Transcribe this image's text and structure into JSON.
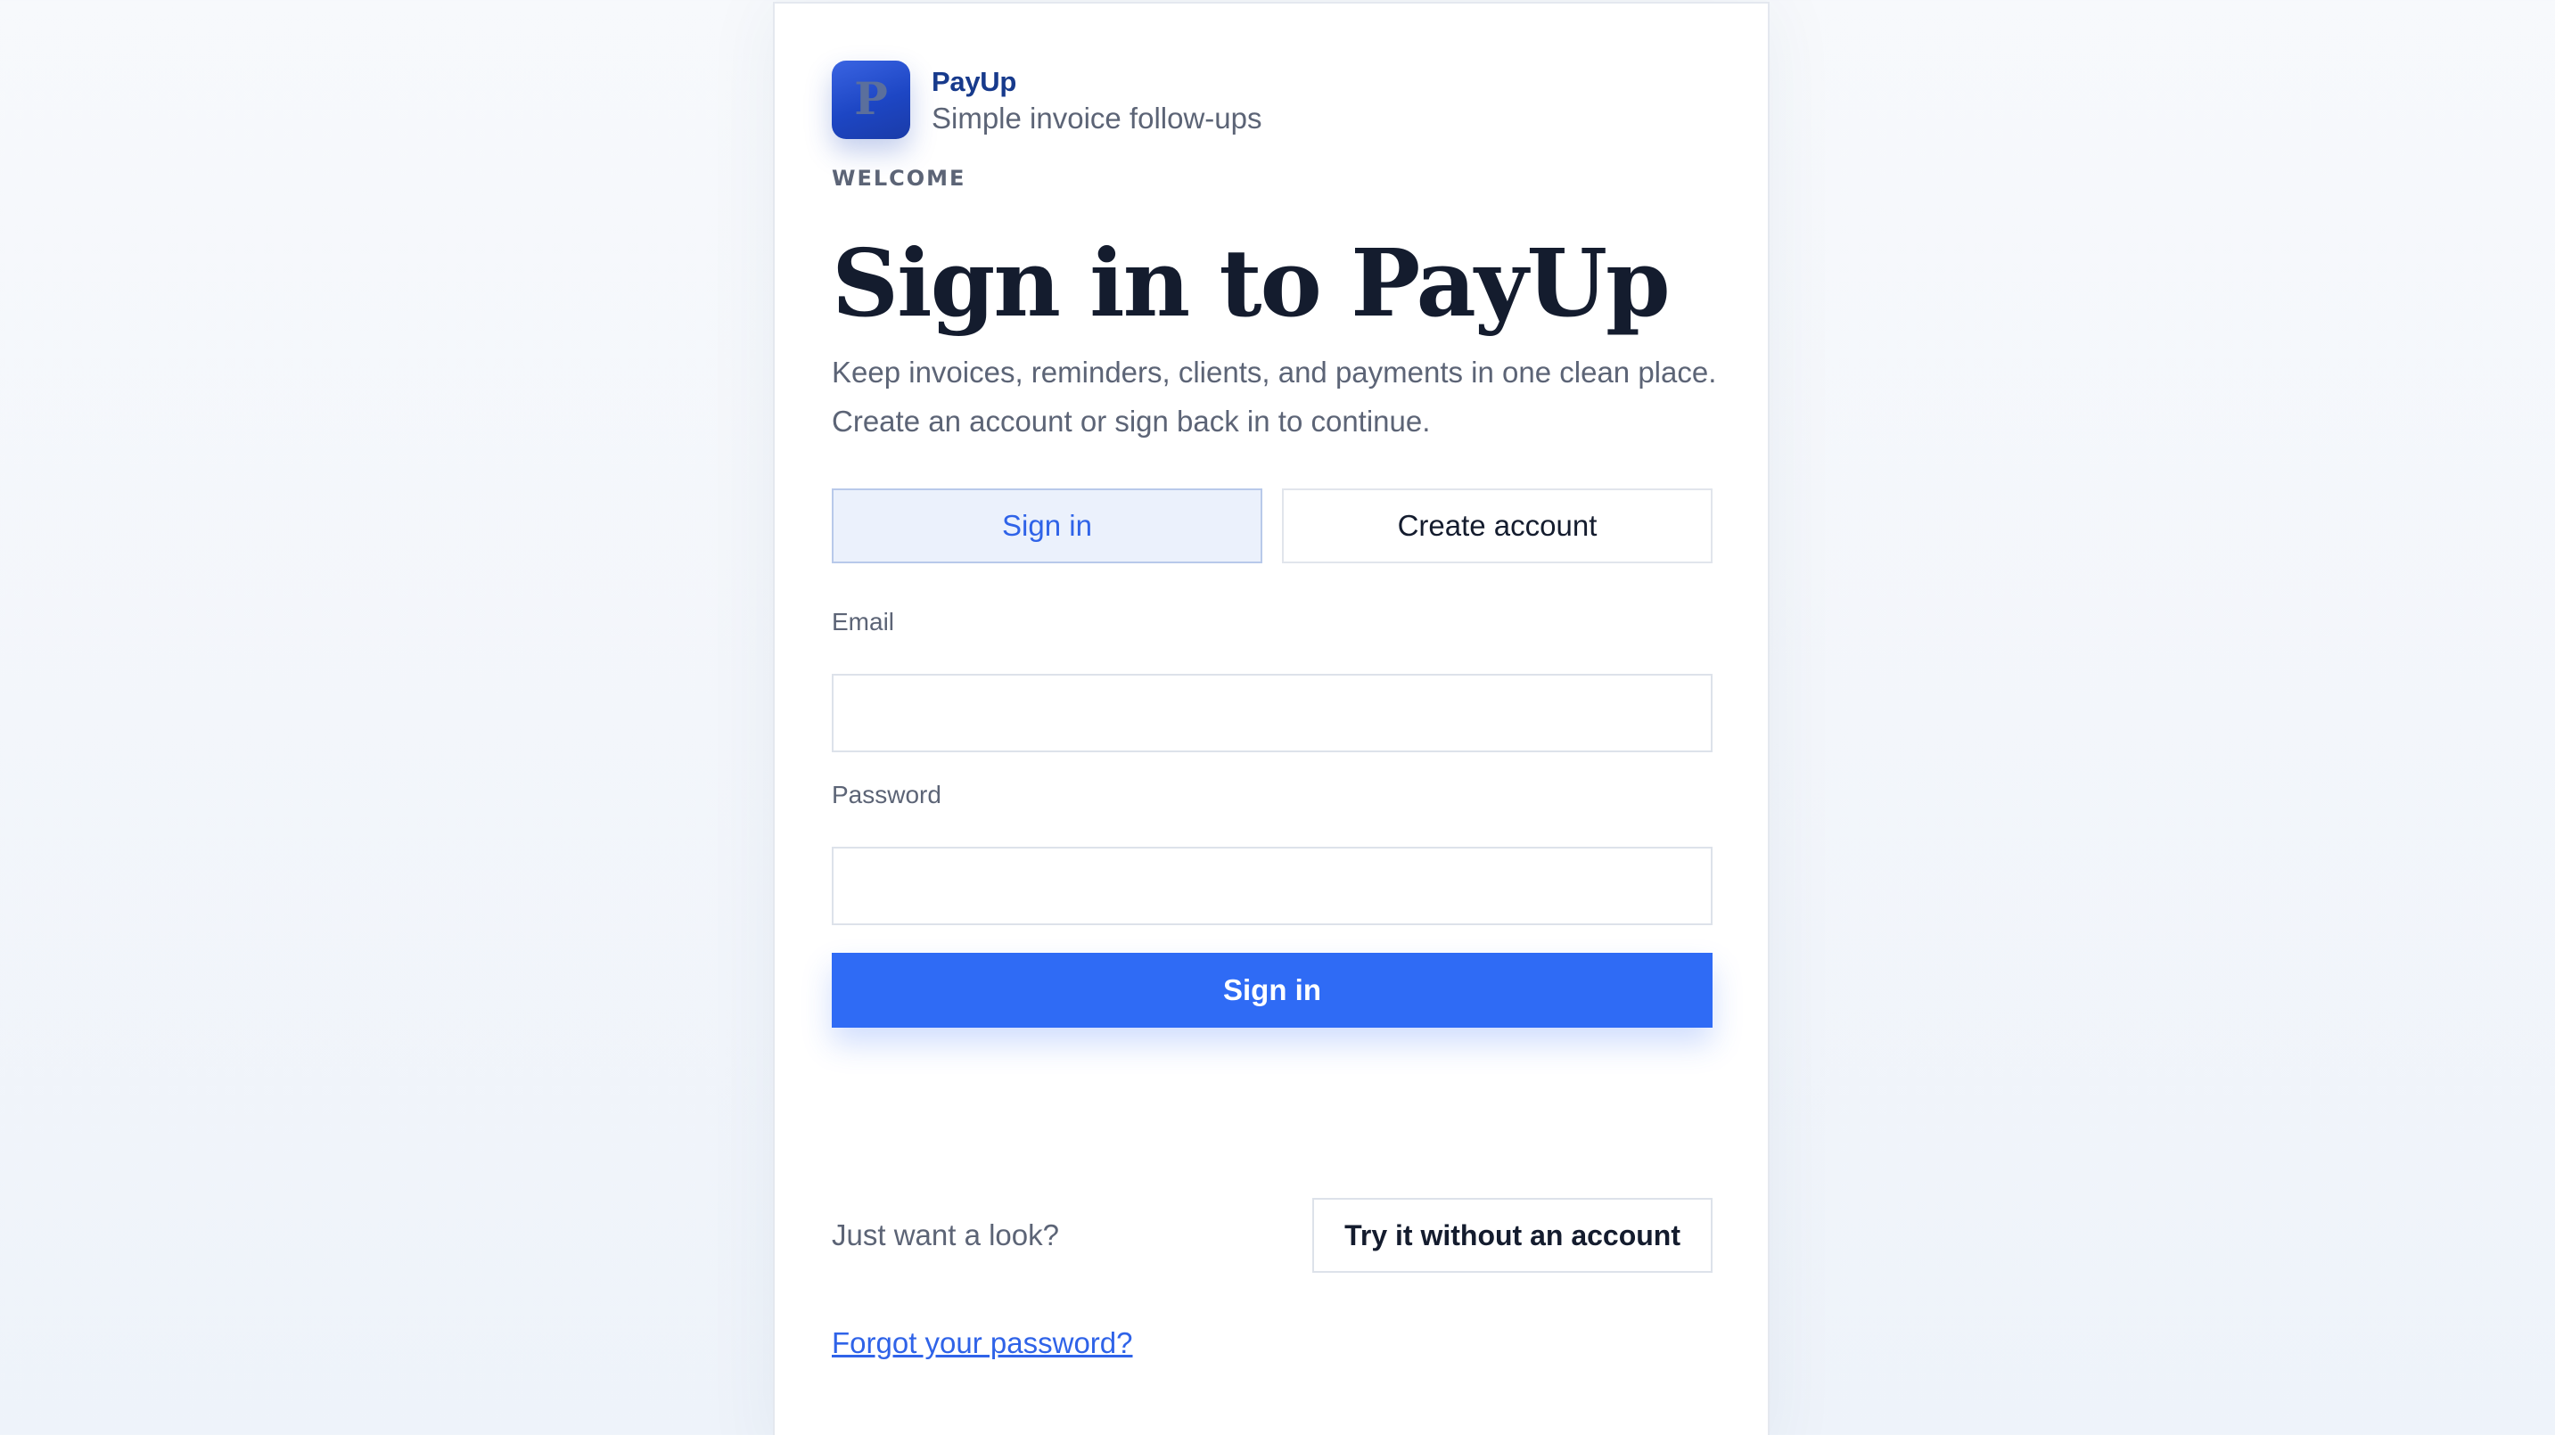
{
  "brand": {
    "logo_letter": "P",
    "name": "PayUp",
    "tagline": "Simple invoice follow-ups"
  },
  "header": {
    "eyebrow": "WELCOME",
    "title": "Sign in to PayUp",
    "subtitle_line1": "Keep invoices, reminders, clients, and payments in one clean place.",
    "subtitle_line2": "Create an account or sign back in to continue."
  },
  "tabs": [
    {
      "label": "Sign in",
      "active": true
    },
    {
      "label": "Create account",
      "active": false
    }
  ],
  "form": {
    "email_label": "Email",
    "email_value": "",
    "password_label": "Password",
    "password_value": "",
    "submit_label": "Sign in"
  },
  "guest": {
    "prompt": "Just want a look?",
    "button_label": "Try it without an account"
  },
  "forgot_link": "Forgot your password?",
  "colors": {
    "accent": "#2f6bf5",
    "brand_text": "#173a8c",
    "title_text": "#141c2e",
    "muted_text": "#5c6476"
  }
}
